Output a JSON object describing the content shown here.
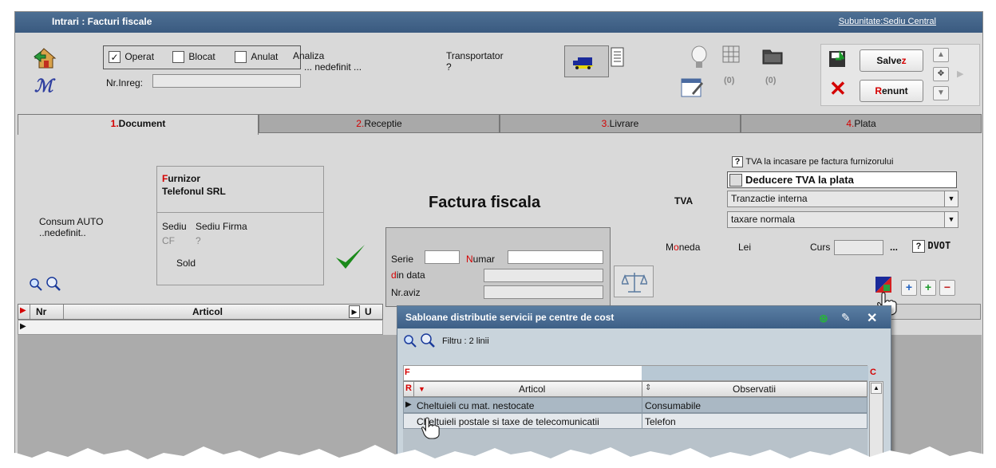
{
  "window": {
    "title": "Intrari : Facturi fiscale",
    "subunit_link": "Subunitate:Sediu Central"
  },
  "status": {
    "operat_label": "Operat",
    "operat_checked": true,
    "blocat_label": "Blocat",
    "anulat_label": "Anulat",
    "nr_inreg_label": "Nr.Inreg:",
    "nr_inreg_value": ""
  },
  "header": {
    "analiza_label": "Analiza",
    "analiza_value": "... nedefinit ...",
    "transportator_label": "Transportator",
    "transportator_value": "?",
    "count_1": "(0)",
    "count_2": "(0)"
  },
  "actions": {
    "save_label_prefix": "Salve",
    "save_label_hotkey": "z",
    "cancel_label_hotkey": "R",
    "cancel_label_rest": "enunt"
  },
  "tabs": [
    {
      "num": "1.",
      "label": "Document",
      "active": true
    },
    {
      "num": "2.",
      "label": "Receptie",
      "active": false
    },
    {
      "num": "3.",
      "label": "Livrare",
      "active": false
    },
    {
      "num": "4.",
      "label": "Plata",
      "active": false
    }
  ],
  "consum": {
    "label": "Consum AUTO",
    "value": "..nedefinit.."
  },
  "furnizor": {
    "label_hotkey": "F",
    "label_rest": "urnizor",
    "name": "Telefonul SRL",
    "sediu_label": "Sediu",
    "sediu_value": "Sediu Firma",
    "cf_label": "CF",
    "cf_value": "?",
    "sold_label": "Sold"
  },
  "document": {
    "heading": "Factura fiscala",
    "serie_label": "Serie",
    "numar_hotkey": "N",
    "numar_rest": "umar",
    "din_hotkey": "d",
    "din_rest": "in data",
    "nr_aviz_label": "Nr.aviz"
  },
  "tva": {
    "label": "TVA",
    "incasare_badge": "?",
    "incasare_label": "TVA la incasare pe factura furnizorului",
    "deducere_label": "Deducere TVA la plata",
    "tranzactie": "Tranzactie interna",
    "taxare": "taxare normala"
  },
  "moneda": {
    "label_prefix": "M",
    "label_hotkey": "o",
    "label_rest": "neda",
    "value": "Lei",
    "curs_label": "Curs",
    "ellipsis": "...",
    "dvot_badge": "?",
    "dvot_label": "DVOT"
  },
  "grid": {
    "col_nr": "Nr",
    "col_articol": "Articol",
    "col_u": "U"
  },
  "popup": {
    "title": "Sabloane distributie servicii pe centre de cost",
    "filter": "Filtru : 2 linii",
    "col_f": "F",
    "col_r": "R",
    "col_c": "C",
    "col_articol": "Articol",
    "col_observatii": "Observatii",
    "rows": [
      {
        "articol": "Cheltuieli cu mat. nestocate",
        "observatii": "Consumabile"
      },
      {
        "articol": "Cheltuieli postale si taxe de telecomunicatii",
        "observatii": "Telefon"
      }
    ]
  },
  "colors": {
    "titlebar": "#3a5a80",
    "accent_red": "#d40000",
    "panel": "#d9d9d9",
    "grid_bg": "#ababab"
  }
}
